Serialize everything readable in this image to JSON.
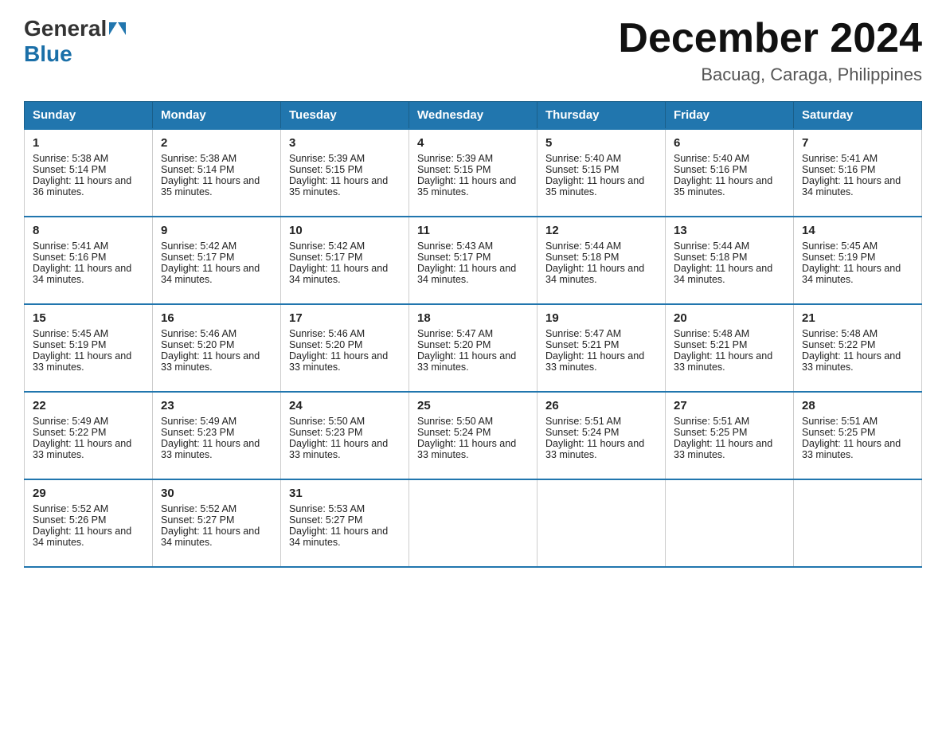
{
  "header": {
    "logo_general": "General",
    "logo_blue": "Blue",
    "month_title": "December 2024",
    "location": "Bacuag, Caraga, Philippines"
  },
  "days_of_week": [
    "Sunday",
    "Monday",
    "Tuesday",
    "Wednesday",
    "Thursday",
    "Friday",
    "Saturday"
  ],
  "weeks": [
    [
      {
        "day": "1",
        "sunrise": "5:38 AM",
        "sunset": "5:14 PM",
        "daylight": "11 hours and 36 minutes."
      },
      {
        "day": "2",
        "sunrise": "5:38 AM",
        "sunset": "5:14 PM",
        "daylight": "11 hours and 35 minutes."
      },
      {
        "day": "3",
        "sunrise": "5:39 AM",
        "sunset": "5:15 PM",
        "daylight": "11 hours and 35 minutes."
      },
      {
        "day": "4",
        "sunrise": "5:39 AM",
        "sunset": "5:15 PM",
        "daylight": "11 hours and 35 minutes."
      },
      {
        "day": "5",
        "sunrise": "5:40 AM",
        "sunset": "5:15 PM",
        "daylight": "11 hours and 35 minutes."
      },
      {
        "day": "6",
        "sunrise": "5:40 AM",
        "sunset": "5:16 PM",
        "daylight": "11 hours and 35 minutes."
      },
      {
        "day": "7",
        "sunrise": "5:41 AM",
        "sunset": "5:16 PM",
        "daylight": "11 hours and 34 minutes."
      }
    ],
    [
      {
        "day": "8",
        "sunrise": "5:41 AM",
        "sunset": "5:16 PM",
        "daylight": "11 hours and 34 minutes."
      },
      {
        "day": "9",
        "sunrise": "5:42 AM",
        "sunset": "5:17 PM",
        "daylight": "11 hours and 34 minutes."
      },
      {
        "day": "10",
        "sunrise": "5:42 AM",
        "sunset": "5:17 PM",
        "daylight": "11 hours and 34 minutes."
      },
      {
        "day": "11",
        "sunrise": "5:43 AM",
        "sunset": "5:17 PM",
        "daylight": "11 hours and 34 minutes."
      },
      {
        "day": "12",
        "sunrise": "5:44 AM",
        "sunset": "5:18 PM",
        "daylight": "11 hours and 34 minutes."
      },
      {
        "day": "13",
        "sunrise": "5:44 AM",
        "sunset": "5:18 PM",
        "daylight": "11 hours and 34 minutes."
      },
      {
        "day": "14",
        "sunrise": "5:45 AM",
        "sunset": "5:19 PM",
        "daylight": "11 hours and 34 minutes."
      }
    ],
    [
      {
        "day": "15",
        "sunrise": "5:45 AM",
        "sunset": "5:19 PM",
        "daylight": "11 hours and 33 minutes."
      },
      {
        "day": "16",
        "sunrise": "5:46 AM",
        "sunset": "5:20 PM",
        "daylight": "11 hours and 33 minutes."
      },
      {
        "day": "17",
        "sunrise": "5:46 AM",
        "sunset": "5:20 PM",
        "daylight": "11 hours and 33 minutes."
      },
      {
        "day": "18",
        "sunrise": "5:47 AM",
        "sunset": "5:20 PM",
        "daylight": "11 hours and 33 minutes."
      },
      {
        "day": "19",
        "sunrise": "5:47 AM",
        "sunset": "5:21 PM",
        "daylight": "11 hours and 33 minutes."
      },
      {
        "day": "20",
        "sunrise": "5:48 AM",
        "sunset": "5:21 PM",
        "daylight": "11 hours and 33 minutes."
      },
      {
        "day": "21",
        "sunrise": "5:48 AM",
        "sunset": "5:22 PM",
        "daylight": "11 hours and 33 minutes."
      }
    ],
    [
      {
        "day": "22",
        "sunrise": "5:49 AM",
        "sunset": "5:22 PM",
        "daylight": "11 hours and 33 minutes."
      },
      {
        "day": "23",
        "sunrise": "5:49 AM",
        "sunset": "5:23 PM",
        "daylight": "11 hours and 33 minutes."
      },
      {
        "day": "24",
        "sunrise": "5:50 AM",
        "sunset": "5:23 PM",
        "daylight": "11 hours and 33 minutes."
      },
      {
        "day": "25",
        "sunrise": "5:50 AM",
        "sunset": "5:24 PM",
        "daylight": "11 hours and 33 minutes."
      },
      {
        "day": "26",
        "sunrise": "5:51 AM",
        "sunset": "5:24 PM",
        "daylight": "11 hours and 33 minutes."
      },
      {
        "day": "27",
        "sunrise": "5:51 AM",
        "sunset": "5:25 PM",
        "daylight": "11 hours and 33 minutes."
      },
      {
        "day": "28",
        "sunrise": "5:51 AM",
        "sunset": "5:25 PM",
        "daylight": "11 hours and 33 minutes."
      }
    ],
    [
      {
        "day": "29",
        "sunrise": "5:52 AM",
        "sunset": "5:26 PM",
        "daylight": "11 hours and 34 minutes."
      },
      {
        "day": "30",
        "sunrise": "5:52 AM",
        "sunset": "5:27 PM",
        "daylight": "11 hours and 34 minutes."
      },
      {
        "day": "31",
        "sunrise": "5:53 AM",
        "sunset": "5:27 PM",
        "daylight": "11 hours and 34 minutes."
      },
      null,
      null,
      null,
      null
    ]
  ]
}
